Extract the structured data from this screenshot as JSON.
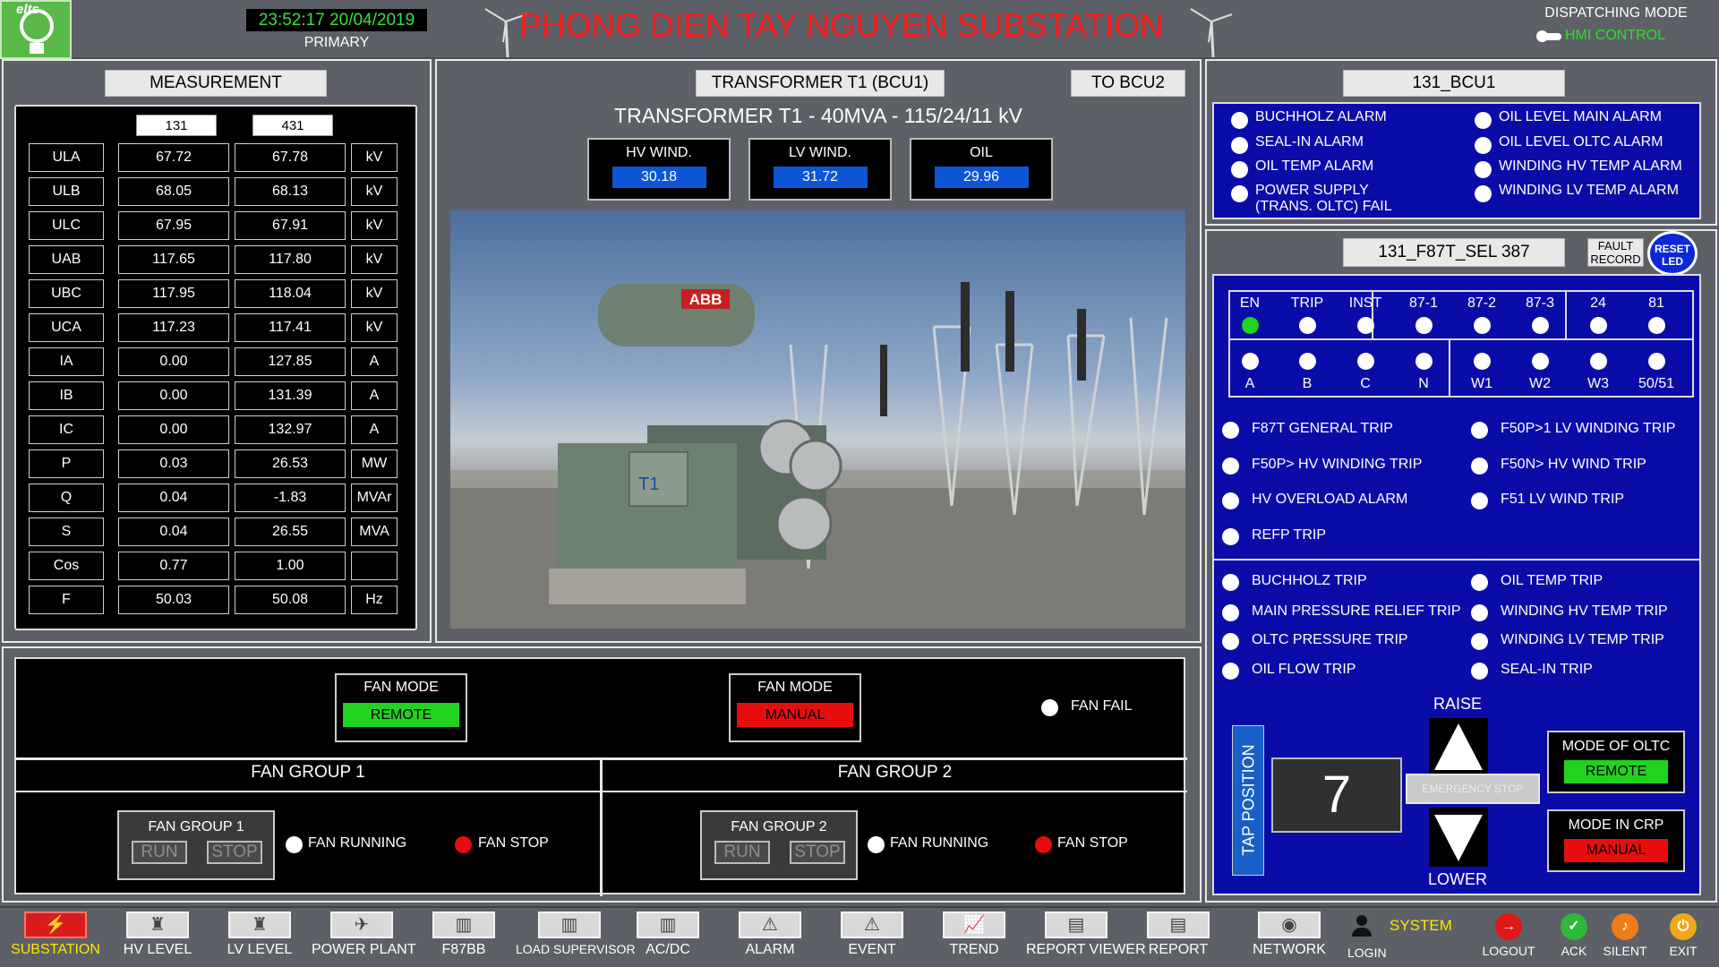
{
  "header": {
    "datetime": "23:52:17 20/04/2019",
    "primary": "PRIMARY",
    "title": "PHONG DIEN TAY NGUYEN SUBSTATION",
    "dispatch_label": "DISPATCHING MODE",
    "dispatch_mode": "HMI CONTROL",
    "logo_text": "elts"
  },
  "measurement": {
    "title": "MEASUREMENT",
    "col1": "131",
    "col2": "431",
    "rows": [
      {
        "name": "ULA",
        "v1": "67.72",
        "v2": "67.78",
        "unit": "kV"
      },
      {
        "name": "ULB",
        "v1": "68.05",
        "v2": "68.13",
        "unit": "kV"
      },
      {
        "name": "ULC",
        "v1": "67.95",
        "v2": "67.91",
        "unit": "kV"
      },
      {
        "name": "UAB",
        "v1": "117.65",
        "v2": "117.80",
        "unit": "kV"
      },
      {
        "name": "UBC",
        "v1": "117.95",
        "v2": "118.04",
        "unit": "kV"
      },
      {
        "name": "UCA",
        "v1": "117.23",
        "v2": "117.41",
        "unit": "kV"
      },
      {
        "name": "IA",
        "v1": "0.00",
        "v2": "127.85",
        "unit": "A"
      },
      {
        "name": "IB",
        "v1": "0.00",
        "v2": "131.39",
        "unit": "A"
      },
      {
        "name": "IC",
        "v1": "0.00",
        "v2": "132.97",
        "unit": "A"
      },
      {
        "name": "P",
        "v1": "0.03",
        "v2": "26.53",
        "unit": "MW"
      },
      {
        "name": "Q",
        "v1": "0.04",
        "v2": "-1.83",
        "unit": "MVAr"
      },
      {
        "name": "S",
        "v1": "0.04",
        "v2": "26.55",
        "unit": "MVA"
      },
      {
        "name": "Cos",
        "v1": "0.77",
        "v2": "1.00",
        "unit": ""
      },
      {
        "name": "F",
        "v1": "50.03",
        "v2": "50.08",
        "unit": "Hz"
      }
    ]
  },
  "transformer": {
    "tab": "TRANSFORMER T1 (BCU1)",
    "to_bcu2": "TO BCU2",
    "subtitle": "TRANSFORMER T1 - 40MVA - 115/24/11 kV",
    "hv_label": "HV WIND.",
    "hv_value": "30.18",
    "lv_label": "LV WIND.",
    "lv_value": "31.72",
    "oil_label": "OIL",
    "oil_value": "29.96",
    "brand": "ABB",
    "tag": "T1"
  },
  "bcu": {
    "title": "131_BCU1",
    "alarms_left": [
      "BUCHHOLZ ALARM",
      "SEAL-IN ALARM",
      "OIL TEMP ALARM",
      "POWER SUPPLY (TRANS. OLTC) FAIL"
    ],
    "alarms_right": [
      "OIL LEVEL MAIN ALARM",
      "OIL LEVEL OLTC ALARM",
      "WINDING HV TEMP ALARM",
      "WINDING LV TEMP ALARM"
    ]
  },
  "relay": {
    "title": "131_F87T_SEL 387",
    "fault_record": "FAULT RECORD",
    "reset_led": "RESET LED",
    "top_labels": [
      "EN",
      "TRIP",
      "INST",
      "87-1",
      "87-2",
      "87-3",
      "24",
      "81"
    ],
    "bottom_labels": [
      "A",
      "B",
      "C",
      "N",
      "W1",
      "W2",
      "W3",
      "50/51"
    ],
    "trips_left": [
      "F87T GENERAL TRIP",
      "F50P> HV WINDING TRIP",
      "HV OVERLOAD ALARM",
      "REFP TRIP"
    ],
    "trips_right": [
      "F50P>1 LV WINDING TRIP",
      "F50N> HV WIND TRIP",
      "F51 LV WIND TRIP"
    ],
    "prot_left": [
      "BUCHHOLZ TRIP",
      "MAIN PRESSURE RELIEF TRIP",
      "OLTC PRESSURE TRIP",
      "OIL FLOW TRIP"
    ],
    "prot_right": [
      "OIL TEMP TRIP",
      "WINDING HV TEMP TRIP",
      "WINDING LV TEMP TRIP",
      "SEAL-IN TRIP"
    ]
  },
  "oltc": {
    "tap_label": "TAP POSITION",
    "tap_value": "7",
    "raise": "RAISE",
    "lower": "LOWER",
    "emergency_stop": "EMERGENCY STOP",
    "mode_oltc_label": "MODE OF OLTC",
    "mode_oltc_value": "REMOTE",
    "mode_crp_label": "MODE IN CRP",
    "mode_crp_value": "MANUAL"
  },
  "fans": {
    "mode_label": "FAN MODE",
    "remote": "REMOTE",
    "manual": "MANUAL",
    "fan_fail": "FAN FAIL",
    "group1_title": "FAN GROUP 1",
    "group2_title": "FAN GROUP 2",
    "group1_box": "FAN GROUP 1",
    "group2_box": "FAN GROUP 2",
    "run": "RUN",
    "stop": "STOP",
    "fan_running": "FAN RUNNING",
    "fan_stop": "FAN STOP"
  },
  "toolbar": {
    "items": [
      "SUBSTATION",
      "HV LEVEL",
      "LV LEVEL",
      "POWER PLANT",
      "F87BB",
      "LOAD SUPERVISOR",
      "AC/DC",
      "ALARM",
      "EVENT",
      "TREND",
      "REPORT VIEWER",
      "REPORT",
      "NETWORK"
    ],
    "system": "SYSTEM",
    "login": "LOGIN",
    "logout": "LOGOUT",
    "ack": "ACK",
    "silent": "SILENT",
    "exit": "EXIT"
  },
  "colors": {
    "accent_blue": "#0a0ca8",
    "value_blue": "#0d56d6",
    "ok_green": "#1fd31f",
    "alarm_red": "#e60d0d",
    "title_red": "#ff1a1a"
  }
}
